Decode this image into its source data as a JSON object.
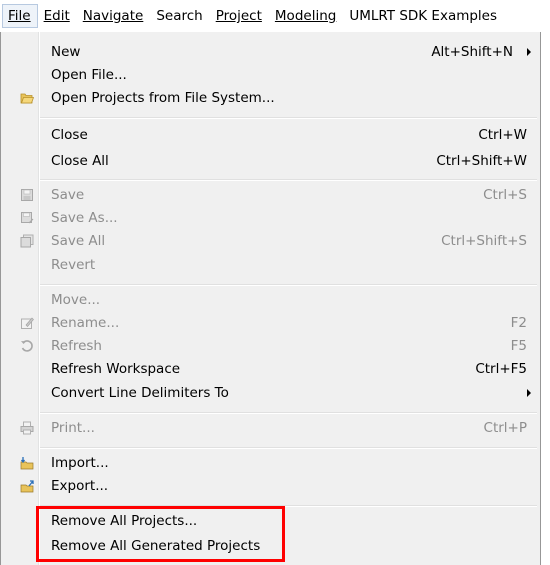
{
  "menubar": {
    "items": [
      {
        "label": "File",
        "name": "menu-file"
      },
      {
        "label": "Edit",
        "name": "menu-edit"
      },
      {
        "label": "Navigate",
        "name": "menu-navigate"
      },
      {
        "label": "Search",
        "name": "menu-search"
      },
      {
        "label": "Project",
        "name": "menu-project"
      },
      {
        "label": "Modeling",
        "name": "menu-modeling"
      },
      {
        "label": "UMLRT SDK Examples",
        "name": "menu-umlrt-sdk-examples"
      }
    ]
  },
  "file_menu": {
    "new": {
      "label": "New",
      "shortcut": "Alt+Shift+N"
    },
    "open_file": {
      "label": "Open File..."
    },
    "open_projects": {
      "label": "Open Projects from File System...",
      "icon": "folder-open-icon"
    },
    "close": {
      "label": "Close",
      "shortcut": "Ctrl+W"
    },
    "close_all": {
      "label": "Close All",
      "shortcut": "Ctrl+Shift+W"
    },
    "save": {
      "label": "Save",
      "shortcut": "Ctrl+S",
      "icon": "save-icon"
    },
    "save_as": {
      "label": "Save As...",
      "icon": "save-as-icon"
    },
    "save_all": {
      "label": "Save All",
      "shortcut": "Ctrl+Shift+S",
      "icon": "save-all-icon"
    },
    "revert": {
      "label": "Revert"
    },
    "move": {
      "label": "Move..."
    },
    "rename": {
      "label": "Rename...",
      "shortcut": "F2",
      "icon": "rename-icon"
    },
    "refresh": {
      "label": "Refresh",
      "shortcut": "F5",
      "icon": "refresh-icon"
    },
    "refresh_workspace": {
      "label": "Refresh Workspace",
      "shortcut": "Ctrl+F5"
    },
    "convert_line_delimiters": {
      "label": "Convert Line Delimiters To"
    },
    "print": {
      "label": "Print...",
      "shortcut": "Ctrl+P",
      "icon": "print-icon"
    },
    "import": {
      "label": "Import...",
      "icon": "import-icon"
    },
    "export": {
      "label": "Export...",
      "icon": "export-icon"
    },
    "remove_all_projects": {
      "label": "Remove All Projects..."
    },
    "remove_all_generated_projects": {
      "label": "Remove All Generated Projects"
    }
  },
  "colors": {
    "highlight": "#ff0000",
    "menu_bg": "#f0f0f0",
    "disabled_text": "#8d8d8d"
  }
}
